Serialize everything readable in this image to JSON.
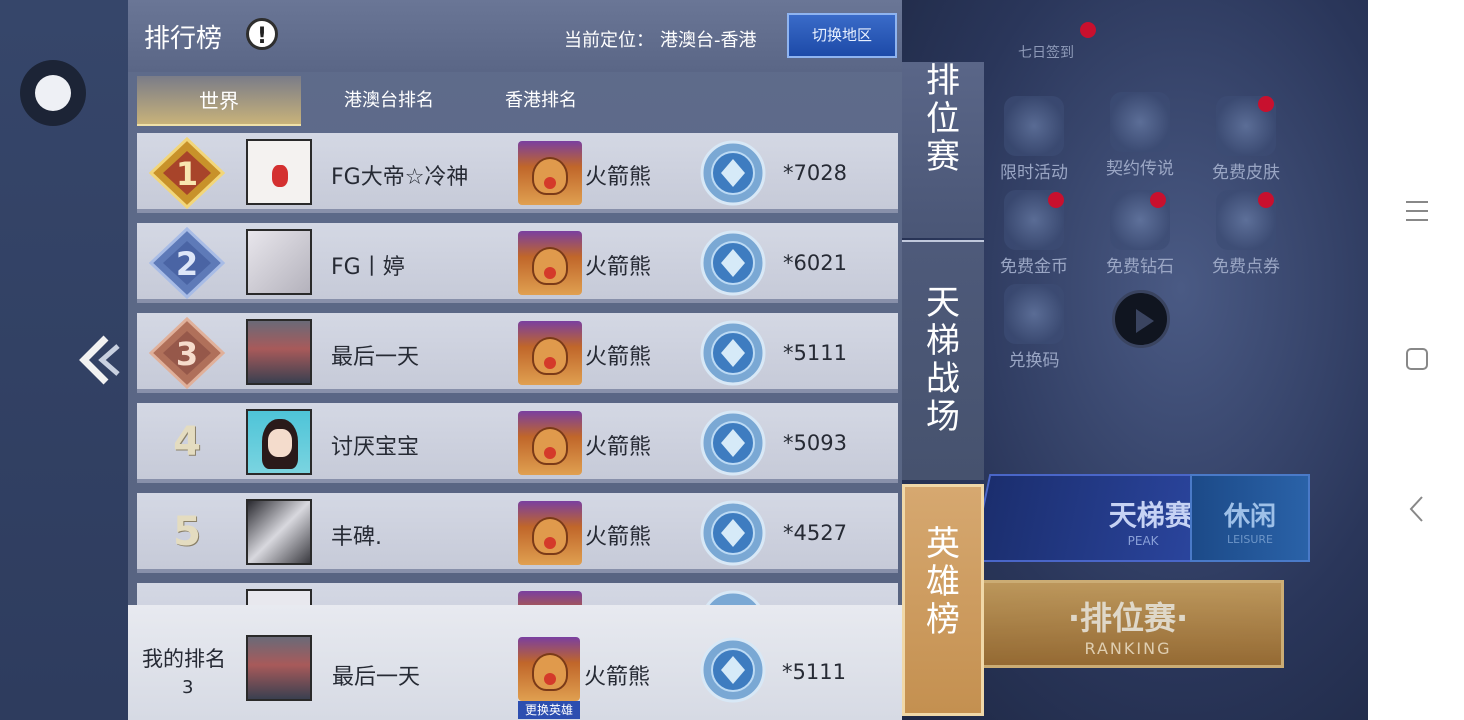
{
  "panel": {
    "title": "排行榜",
    "info_glyph": "!",
    "location_label": "当前定位：",
    "location_value": "港澳台-香港",
    "switch_button": "切换地区"
  },
  "tabs": [
    {
      "label": "世界",
      "active": true
    },
    {
      "label": "港澳台排名",
      "active": false
    },
    {
      "label": "香港排名",
      "active": false
    }
  ],
  "rows": [
    {
      "rank": "1",
      "player": "FG大帝☆冷神",
      "hero": "火箭熊",
      "score": "*7028"
    },
    {
      "rank": "2",
      "player": "FG丨婷",
      "hero": "火箭熊",
      "score": "*6021"
    },
    {
      "rank": "3",
      "player": "最后一天",
      "hero": "火箭熊",
      "score": "*5111"
    },
    {
      "rank": "4",
      "player": "讨厌宝宝",
      "hero": "火箭熊",
      "score": "*5093"
    },
    {
      "rank": "5",
      "player": "丰碑.",
      "hero": "火箭熊",
      "score": "*4527"
    }
  ],
  "my_rank": {
    "label": "我的排名",
    "rank": "3",
    "player": "最后一天",
    "hero": "火箭熊",
    "change_hero": "更换英雄",
    "score": "*5111"
  },
  "side_tabs": [
    {
      "label": "排位赛",
      "active": false
    },
    {
      "label": "天梯战场",
      "active": false
    },
    {
      "label": "英雄榜",
      "active": true
    }
  ],
  "background": {
    "top_label": "七日签到",
    "icons": [
      "限时活动",
      "契约传说",
      "免费皮肤",
      "免费金币",
      "免费钻石",
      "免费点券",
      "兑换码"
    ],
    "ladder_title": "天梯赛",
    "ladder_sub": "PEAK",
    "leisure_title": "休闲",
    "leisure_sub": "LEISURE",
    "ranking_title": "·排位赛·",
    "ranking_sub": "RANKING"
  },
  "colors": {
    "panel_bg": "#5f6c8c",
    "row_bg": "#d0d4e0",
    "active_side_tab": "#d6a870",
    "switch_button": "#2a5cbc"
  },
  "icons": {
    "floating_ball": "circle-dot-icon",
    "collapse": "double-chevron-left-icon",
    "nav_menu": "hamburger-icon",
    "nav_home": "square-icon",
    "nav_back": "chevron-left-icon"
  }
}
